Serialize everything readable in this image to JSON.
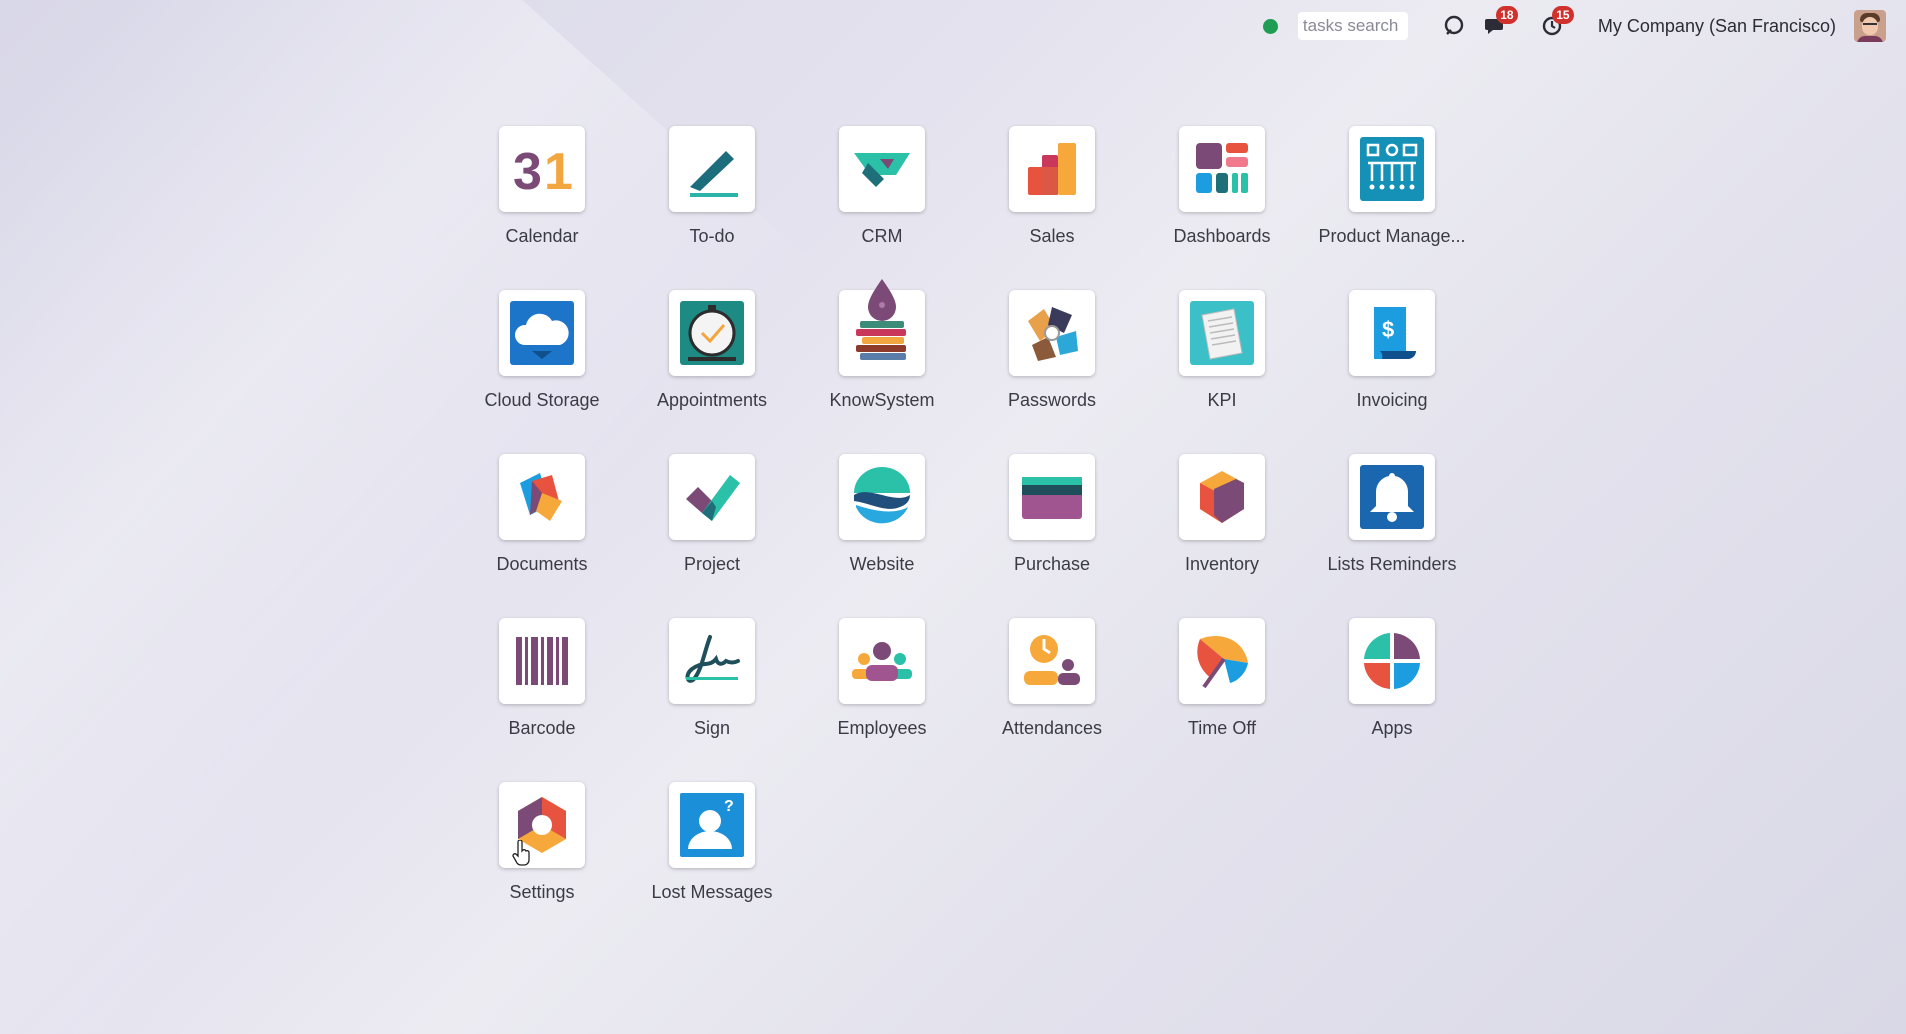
{
  "topbar": {
    "search_placeholder": "tasks search",
    "messages_badge": "18",
    "activities_badge": "15",
    "company": "My Company (San Francisco)"
  },
  "apps": [
    {
      "label": "Calendar",
      "icon": "calendar-icon"
    },
    {
      "label": "To-do",
      "icon": "todo-icon"
    },
    {
      "label": "CRM",
      "icon": "crm-icon"
    },
    {
      "label": "Sales",
      "icon": "sales-icon"
    },
    {
      "label": "Dashboards",
      "icon": "dashboards-icon"
    },
    {
      "label": "Product Manage...",
      "icon": "product-management-icon"
    },
    {
      "label": "Cloud Storage",
      "icon": "cloud-storage-icon"
    },
    {
      "label": "Appointments",
      "icon": "appointments-icon"
    },
    {
      "label": "KnowSystem",
      "icon": "knowsystem-icon"
    },
    {
      "label": "Passwords",
      "icon": "passwords-icon"
    },
    {
      "label": "KPI",
      "icon": "kpi-icon"
    },
    {
      "label": "Invoicing",
      "icon": "invoicing-icon"
    },
    {
      "label": "Documents",
      "icon": "documents-icon"
    },
    {
      "label": "Project",
      "icon": "project-icon"
    },
    {
      "label": "Website",
      "icon": "website-icon"
    },
    {
      "label": "Purchase",
      "icon": "purchase-icon"
    },
    {
      "label": "Inventory",
      "icon": "inventory-icon"
    },
    {
      "label": "Lists Reminders",
      "icon": "lists-reminders-icon"
    },
    {
      "label": "Barcode",
      "icon": "barcode-icon"
    },
    {
      "label": "Sign",
      "icon": "sign-icon"
    },
    {
      "label": "Employees",
      "icon": "employees-icon"
    },
    {
      "label": "Attendances",
      "icon": "attendances-icon"
    },
    {
      "label": "Time Off",
      "icon": "time-off-icon"
    },
    {
      "label": "Apps",
      "icon": "apps-icon"
    },
    {
      "label": "Settings",
      "icon": "settings-icon"
    },
    {
      "label": "Lost Messages",
      "icon": "lost-messages-icon"
    }
  ]
}
